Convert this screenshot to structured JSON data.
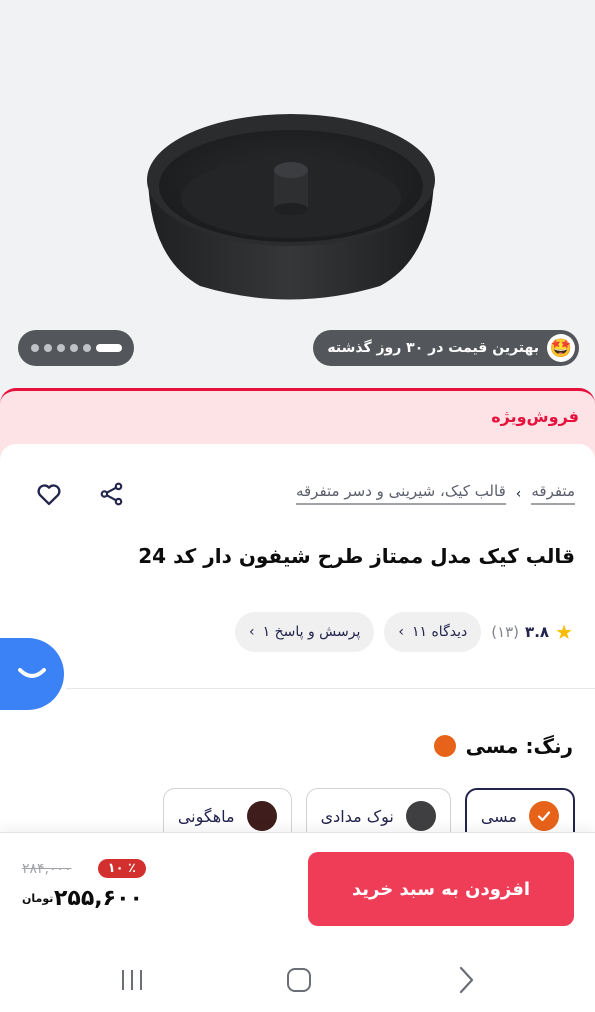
{
  "hero": {
    "product_image": "black chiffon cake mold",
    "best_price_badge": "بهترین قیمت در ۳۰ روز گذشته",
    "badge_icon": "star-struck-emoji",
    "carousel": {
      "total": 6,
      "active": 1
    }
  },
  "sale": {
    "title": "فروش‌ویژه"
  },
  "breadcrumb": {
    "items": [
      "متفرقه",
      "قالب کیک، شیرینی و دسر متفرقه"
    ]
  },
  "product": {
    "title": "قالب کیک مدل ممتاز طرح شیفون دار کد 24"
  },
  "stats": {
    "rating": "۳.۸",
    "rating_count": "(۱۳)",
    "reviews_chip": "۱۱ دیدگاه",
    "qa_chip": "۱ پرسش و پاسخ"
  },
  "color": {
    "label": "رنگ: مسی",
    "accent": "#e8631a",
    "options": [
      {
        "label": "مسی",
        "color": "#e8631a",
        "selected": true
      },
      {
        "label": "نوک مدادی",
        "color": "#3f3f41",
        "selected": false
      },
      {
        "label": "ماهگونی",
        "color": "#3f1d1d",
        "selected": false
      }
    ]
  },
  "purchase": {
    "add_to_cart": "افزودن به سبد خرید",
    "old_price": "۲۸۴,۰۰۰",
    "discount": "۱۰ ٪",
    "new_price": "۲۵۵,۶۰۰",
    "currency": "تومان",
    "button_color": "#ef3d58"
  }
}
